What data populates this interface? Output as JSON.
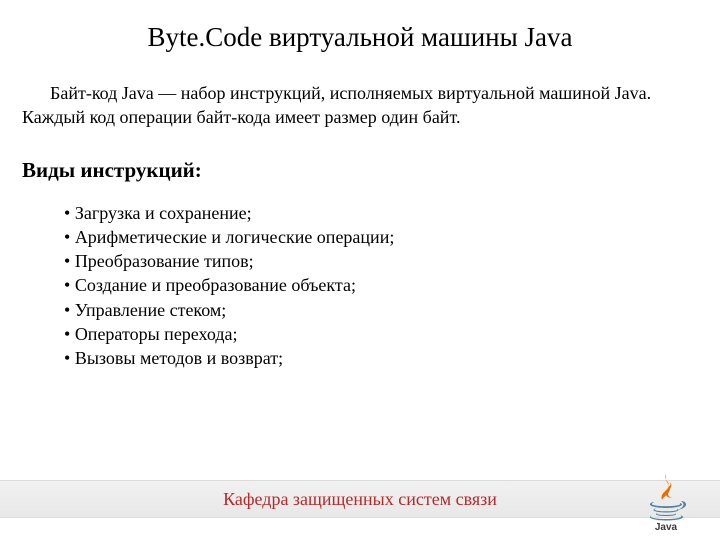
{
  "title": "Byte.Code виртуальной машины Java",
  "intro": "Байт-код Java — набор инструкций, исполняемых виртуальной машиной Java. Каждый код операции байт-кода имеет размер один байт.",
  "section_heading": "Виды инструкций:",
  "bullets": [
    "Загрузка и сохранение;",
    "Арифметические и логические операции;",
    "Преобразование типов;",
    "Создание и преобразование объекта;",
    "Управление стеком;",
    "Операторы перехода;",
    "Вызовы методов и возврат;"
  ],
  "footer": "Кафедра защищенных систем связи",
  "logo_label": "Java"
}
